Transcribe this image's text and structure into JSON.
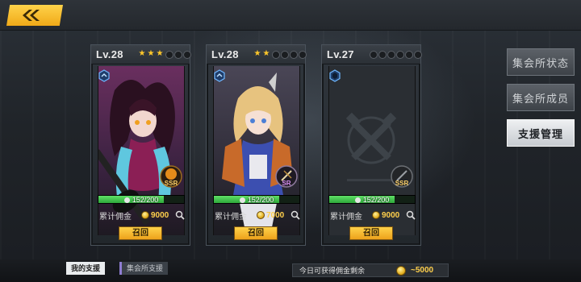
{
  "header": {
    "back_icon": "back-arrow-icon"
  },
  "cards": [
    {
      "level": "Lv.28",
      "stars_on": 3,
      "stars_total": 6,
      "rank": "SSR",
      "hp": "152/200",
      "hp_fraction": 0.76,
      "fee_label": "累计佣金",
      "fee_value": "9000",
      "recall_label": "召回",
      "theme": "#c03d8f",
      "occupied": true
    },
    {
      "level": "Lv.28",
      "stars_on": 2,
      "stars_total": 6,
      "rank": "SR",
      "hp": "152/200",
      "hp_fraction": 0.76,
      "fee_label": "累计佣金",
      "fee_value": "7000",
      "recall_label": "召回",
      "theme": "#c7a35a",
      "occupied": true
    },
    {
      "level": "Lv.27",
      "stars_on": 0,
      "stars_total": 6,
      "rank": "SSR",
      "hp": "152/200",
      "hp_fraction": 0.76,
      "fee_label": "累计佣金",
      "fee_value": "9000",
      "recall_label": "召回",
      "theme": "#5d646c",
      "occupied": false
    }
  ],
  "sidebar": {
    "items": [
      {
        "label": "集会所状态",
        "active": false
      },
      {
        "label": "集会所成员",
        "active": false
      },
      {
        "label": "支援管理",
        "active": true
      }
    ]
  },
  "footer": {
    "tab_mine": "我的支援",
    "tab_hall": "集会所支援",
    "remain_label": "今日可获得佣金剩余",
    "remain_value": "~5000"
  },
  "colors": {
    "accent": "#f5b82a",
    "hp_green": "#3fbf4a",
    "coin": "#e4b022"
  }
}
